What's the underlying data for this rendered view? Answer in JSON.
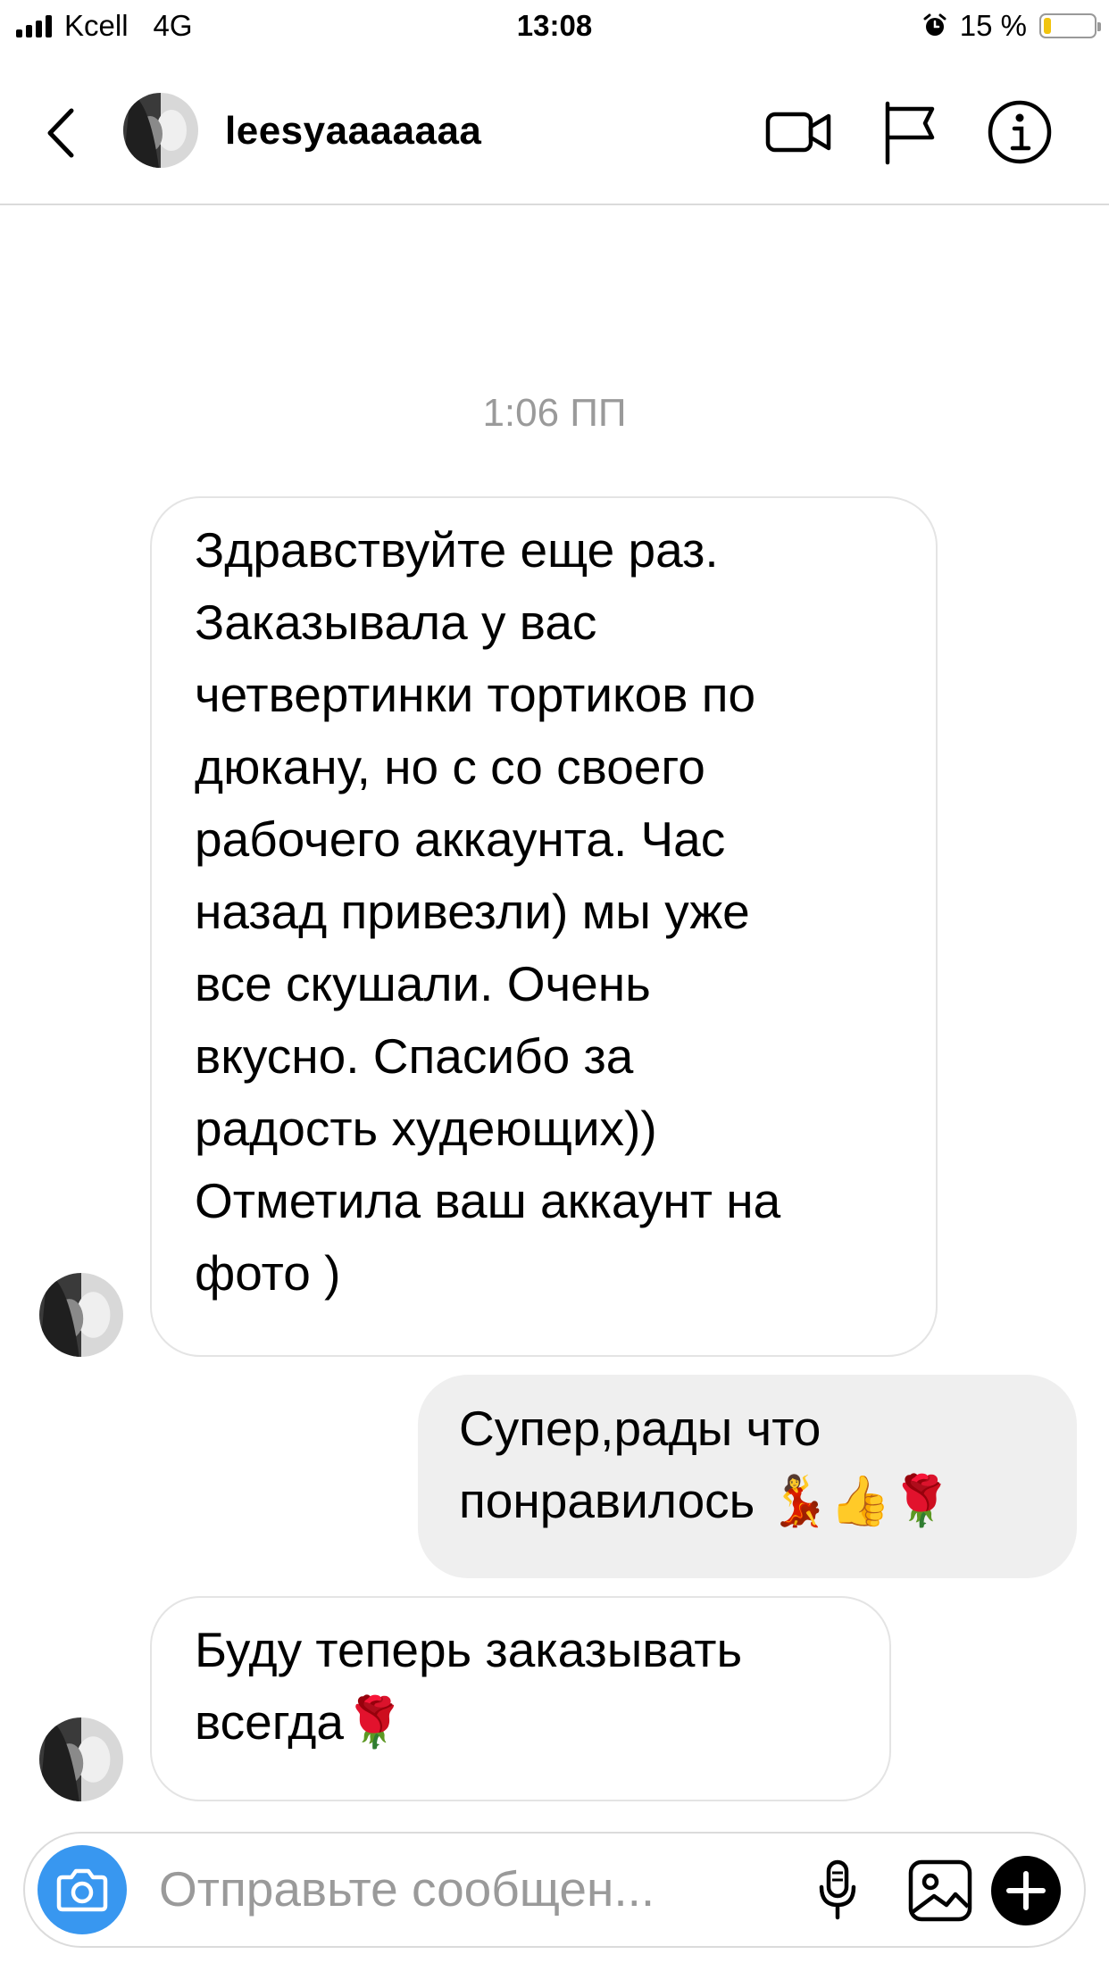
{
  "status_bar": {
    "carrier": "Kcell",
    "network": "4G",
    "time": "13:08",
    "battery_percent": "15 %",
    "battery_level": 0.15,
    "alarm_icon": "alarm-clock-icon"
  },
  "header": {
    "username": "leesyaaaaaaa",
    "icons": [
      "back-chevron-icon",
      "video-call-icon",
      "flag-icon",
      "info-icon"
    ]
  },
  "chat": {
    "timestamp": "1:06 ПП",
    "messages": [
      {
        "direction": "incoming",
        "lines": [
          "Здравствуйте еще раз.",
          "Заказывала у вас",
          "четвертинки тортиков по",
          "дюкану, но с со своего",
          "рабочего аккаунта. Час",
          "назад привезли) мы уже",
          "все скушали. Очень",
          "вкусно. Спасибо за",
          "радость худеющих))",
          "Отметила ваш аккаунт на",
          "фото )"
        ]
      },
      {
        "direction": "outgoing",
        "lines": [
          "Супер,рады что",
          "понравилось 💃👍🌹"
        ]
      },
      {
        "direction": "incoming",
        "lines": [
          "Буду теперь заказывать",
          "всегда🌹"
        ]
      }
    ]
  },
  "composer": {
    "placeholder": "Отправьте сообщен...",
    "icons": [
      "camera-icon",
      "microphone-icon",
      "gallery-icon",
      "plus-icon"
    ]
  },
  "colors": {
    "accent_blue": "#3897f0",
    "outgoing_bubble": "#efefef",
    "muted_text": "#9a9a9a",
    "battery_low": "#f1c40f"
  }
}
